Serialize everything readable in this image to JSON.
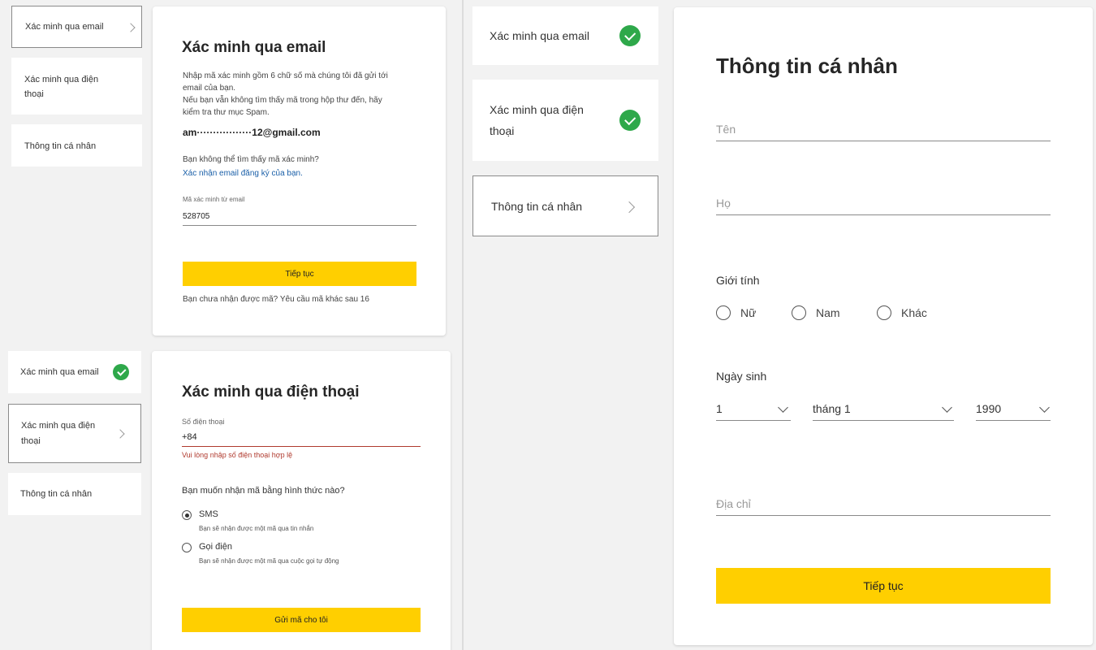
{
  "steps": {
    "email": "Xác minh qua email",
    "phone": "Xác minh qua điện thoại",
    "phone_line1": "Xác minh qua điện",
    "phone_line2": "thoại",
    "personal": "Thông tin cá nhân"
  },
  "email_card": {
    "title": "Xác minh qua email",
    "desc1": "Nhập mã xác minh gồm 6 chữ số mà chúng tôi đã gửi tới",
    "desc2": "email của bạn.",
    "desc3": "Nếu bạn vẫn không tìm thấy mã trong hộp thư đến, hãy",
    "desc4": "kiểm tra thư mục Spam.",
    "email": "am·················12@gmail.com",
    "cant_find": "Bạn không thể tìm thấy mã xác minh?",
    "confirm_link": "Xác nhận email đăng ký của bạn.",
    "code_label": "Mã xác minh từ email",
    "code_value": "528705",
    "continue": "Tiếp tục",
    "resend_text": "Bạn chưa nhận được mã?  Yêu cầu mã khác sau 16"
  },
  "phone_card": {
    "title": "Xác minh qua điện thoại",
    "phone_label": "Số điện thoại",
    "phone_value": "+84",
    "error": "Vui lòng nhập số điện thoại hợp lệ",
    "question": "Bạn muốn nhận mã bằng hình thức nào?",
    "sms_label": "SMS",
    "sms_desc": "Bạn sẽ nhận được một mã qua tin nhắn",
    "call_label": "Gọi điện",
    "call_desc": "Bạn sẽ nhận được một mã qua cuộc gọi tự động",
    "send": "Gửi mã cho tôi"
  },
  "personal_card": {
    "title": "Thông tin cá nhân",
    "first_name_placeholder": "Tên",
    "last_name_placeholder": "Họ",
    "gender_label": "Giới tính",
    "gender_female": "Nữ",
    "gender_male": "Nam",
    "gender_other": "Khác",
    "dob_label": "Ngày sinh",
    "dob_day": "1",
    "dob_month": "tháng 1",
    "dob_year": "1990",
    "address_placeholder": "Địa chỉ",
    "continue": "Tiếp tục"
  },
  "colors": {
    "accent": "#ffcf00",
    "success": "#2ea84a",
    "error": "#b03a2e",
    "link": "#1a5fa8"
  }
}
